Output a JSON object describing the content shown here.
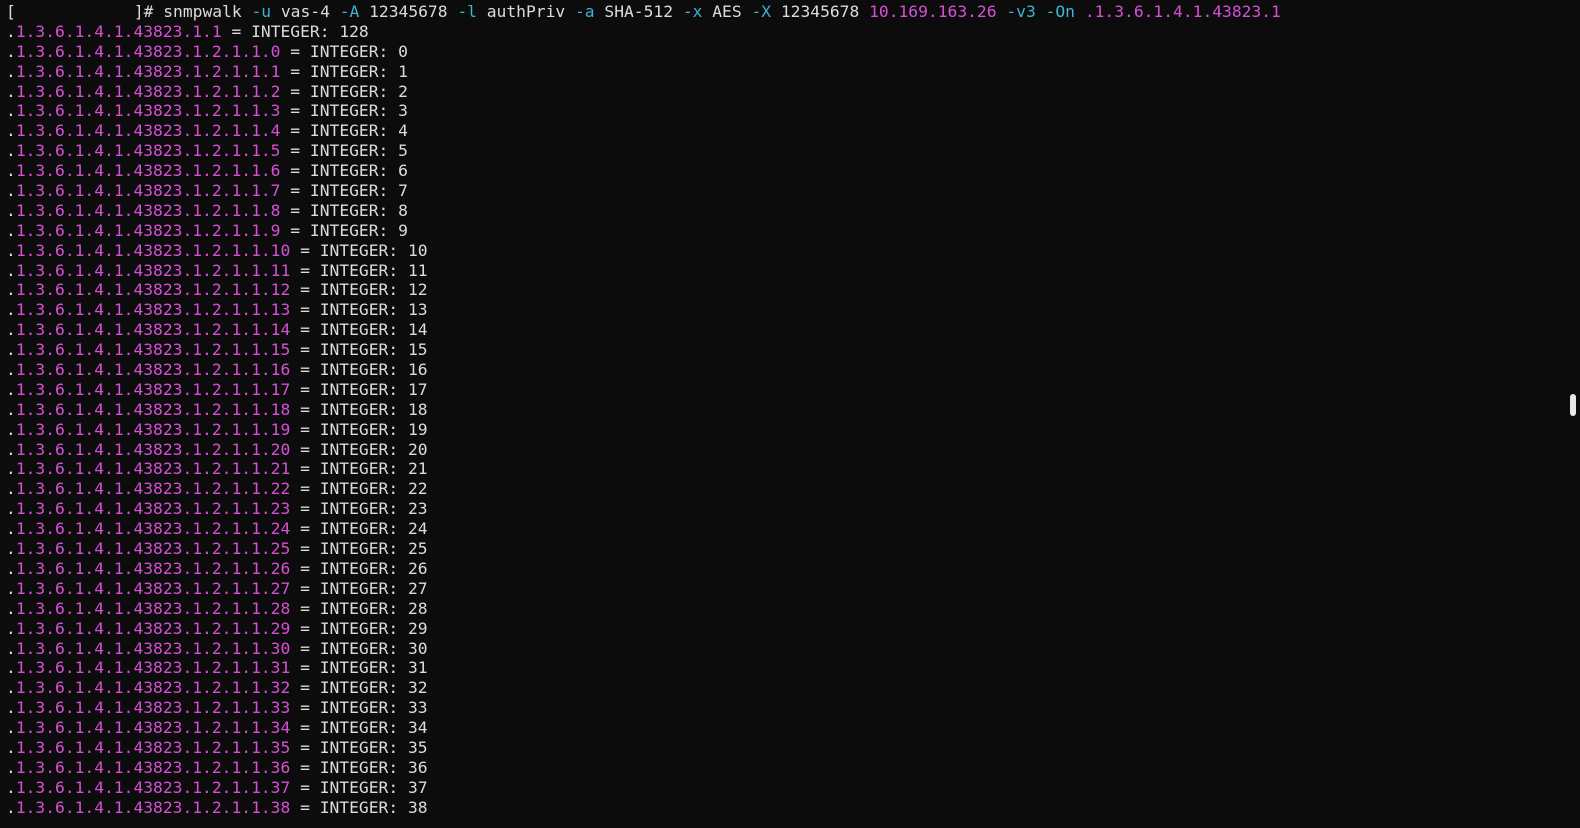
{
  "command": {
    "bracket_open": "[",
    "bracket_close": "]#",
    "program": "snmpwalk",
    "segments": [
      {
        "text": " "
      },
      {
        "text": "-u",
        "kind": "flag"
      },
      {
        "text": " vas-4 "
      },
      {
        "text": "-A",
        "kind": "flag"
      },
      {
        "text": " 12345678 "
      },
      {
        "text": "-l",
        "kind": "flag"
      },
      {
        "text": " authPriv "
      },
      {
        "text": "-a",
        "kind": "flag"
      },
      {
        "text": " SHA-512 "
      },
      {
        "text": "-x",
        "kind": "flag"
      },
      {
        "text": " AES "
      },
      {
        "text": "-X",
        "kind": "flag"
      },
      {
        "text": " 12345678 "
      },
      {
        "text": "10.169.163.26",
        "kind": "ip"
      },
      {
        "text": " "
      },
      {
        "text": "-v3",
        "kind": "flag"
      },
      {
        "text": " "
      },
      {
        "text": "-On",
        "kind": "flag"
      },
      {
        "text": " "
      },
      {
        "text": ".1.3.6.1.4.1.43823.1",
        "kind": "oid"
      }
    ]
  },
  "colors": {
    "background": "#0c0c0c",
    "text": "#dcdcdc",
    "oid": "#d74fd6",
    "flag": "#3bb4d6"
  },
  "output": [
    {
      "oid": ".1.3.6.1.4.1.43823.1.1",
      "type": "INTEGER",
      "value": "128"
    },
    {
      "oid": ".1.3.6.1.4.1.43823.1.2.1.1.0",
      "type": "INTEGER",
      "value": "0"
    },
    {
      "oid": ".1.3.6.1.4.1.43823.1.2.1.1.1",
      "type": "INTEGER",
      "value": "1"
    },
    {
      "oid": ".1.3.6.1.4.1.43823.1.2.1.1.2",
      "type": "INTEGER",
      "value": "2"
    },
    {
      "oid": ".1.3.6.1.4.1.43823.1.2.1.1.3",
      "type": "INTEGER",
      "value": "3"
    },
    {
      "oid": ".1.3.6.1.4.1.43823.1.2.1.1.4",
      "type": "INTEGER",
      "value": "4"
    },
    {
      "oid": ".1.3.6.1.4.1.43823.1.2.1.1.5",
      "type": "INTEGER",
      "value": "5"
    },
    {
      "oid": ".1.3.6.1.4.1.43823.1.2.1.1.6",
      "type": "INTEGER",
      "value": "6"
    },
    {
      "oid": ".1.3.6.1.4.1.43823.1.2.1.1.7",
      "type": "INTEGER",
      "value": "7"
    },
    {
      "oid": ".1.3.6.1.4.1.43823.1.2.1.1.8",
      "type": "INTEGER",
      "value": "8"
    },
    {
      "oid": ".1.3.6.1.4.1.43823.1.2.1.1.9",
      "type": "INTEGER",
      "value": "9"
    },
    {
      "oid": ".1.3.6.1.4.1.43823.1.2.1.1.10",
      "type": "INTEGER",
      "value": "10"
    },
    {
      "oid": ".1.3.6.1.4.1.43823.1.2.1.1.11",
      "type": "INTEGER",
      "value": "11"
    },
    {
      "oid": ".1.3.6.1.4.1.43823.1.2.1.1.12",
      "type": "INTEGER",
      "value": "12"
    },
    {
      "oid": ".1.3.6.1.4.1.43823.1.2.1.1.13",
      "type": "INTEGER",
      "value": "13"
    },
    {
      "oid": ".1.3.6.1.4.1.43823.1.2.1.1.14",
      "type": "INTEGER",
      "value": "14"
    },
    {
      "oid": ".1.3.6.1.4.1.43823.1.2.1.1.15",
      "type": "INTEGER",
      "value": "15"
    },
    {
      "oid": ".1.3.6.1.4.1.43823.1.2.1.1.16",
      "type": "INTEGER",
      "value": "16"
    },
    {
      "oid": ".1.3.6.1.4.1.43823.1.2.1.1.17",
      "type": "INTEGER",
      "value": "17"
    },
    {
      "oid": ".1.3.6.1.4.1.43823.1.2.1.1.18",
      "type": "INTEGER",
      "value": "18"
    },
    {
      "oid": ".1.3.6.1.4.1.43823.1.2.1.1.19",
      "type": "INTEGER",
      "value": "19"
    },
    {
      "oid": ".1.3.6.1.4.1.43823.1.2.1.1.20",
      "type": "INTEGER",
      "value": "20"
    },
    {
      "oid": ".1.3.6.1.4.1.43823.1.2.1.1.21",
      "type": "INTEGER",
      "value": "21"
    },
    {
      "oid": ".1.3.6.1.4.1.43823.1.2.1.1.22",
      "type": "INTEGER",
      "value": "22"
    },
    {
      "oid": ".1.3.6.1.4.1.43823.1.2.1.1.23",
      "type": "INTEGER",
      "value": "23"
    },
    {
      "oid": ".1.3.6.1.4.1.43823.1.2.1.1.24",
      "type": "INTEGER",
      "value": "24"
    },
    {
      "oid": ".1.3.6.1.4.1.43823.1.2.1.1.25",
      "type": "INTEGER",
      "value": "25"
    },
    {
      "oid": ".1.3.6.1.4.1.43823.1.2.1.1.26",
      "type": "INTEGER",
      "value": "26"
    },
    {
      "oid": ".1.3.6.1.4.1.43823.1.2.1.1.27",
      "type": "INTEGER",
      "value": "27"
    },
    {
      "oid": ".1.3.6.1.4.1.43823.1.2.1.1.28",
      "type": "INTEGER",
      "value": "28"
    },
    {
      "oid": ".1.3.6.1.4.1.43823.1.2.1.1.29",
      "type": "INTEGER",
      "value": "29"
    },
    {
      "oid": ".1.3.6.1.4.1.43823.1.2.1.1.30",
      "type": "INTEGER",
      "value": "30"
    },
    {
      "oid": ".1.3.6.1.4.1.43823.1.2.1.1.31",
      "type": "INTEGER",
      "value": "31"
    },
    {
      "oid": ".1.3.6.1.4.1.43823.1.2.1.1.32",
      "type": "INTEGER",
      "value": "32"
    },
    {
      "oid": ".1.3.6.1.4.1.43823.1.2.1.1.33",
      "type": "INTEGER",
      "value": "33"
    },
    {
      "oid": ".1.3.6.1.4.1.43823.1.2.1.1.34",
      "type": "INTEGER",
      "value": "34"
    },
    {
      "oid": ".1.3.6.1.4.1.43823.1.2.1.1.35",
      "type": "INTEGER",
      "value": "35"
    },
    {
      "oid": ".1.3.6.1.4.1.43823.1.2.1.1.36",
      "type": "INTEGER",
      "value": "36"
    },
    {
      "oid": ".1.3.6.1.4.1.43823.1.2.1.1.37",
      "type": "INTEGER",
      "value": "37"
    },
    {
      "oid": ".1.3.6.1.4.1.43823.1.2.1.1.38",
      "type": "INTEGER",
      "value": "38"
    }
  ]
}
